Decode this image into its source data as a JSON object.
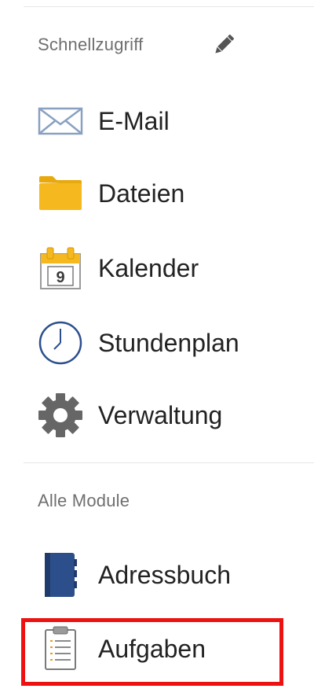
{
  "quick_access": {
    "title": "Schnellzugriff",
    "edit_icon": "pencil-icon",
    "items": [
      {
        "label": "E-Mail",
        "icon": "envelope-icon"
      },
      {
        "label": "Dateien",
        "icon": "folder-icon"
      },
      {
        "label": "Kalender",
        "icon": "calendar-icon"
      },
      {
        "label": "Stundenplan",
        "icon": "clock-icon"
      },
      {
        "label": "Verwaltung",
        "icon": "gear-icon"
      }
    ]
  },
  "all_modules": {
    "title": "Alle Module",
    "items": [
      {
        "label": "Adressbuch",
        "icon": "address-book-icon"
      },
      {
        "label": "Aufgaben",
        "icon": "clipboard-icon",
        "highlighted": true
      }
    ]
  },
  "calendar_icon_day": "9",
  "colors": {
    "highlight": "#ee1111",
    "folder": "#f5b81e",
    "icon_blue": "#2c4f8c",
    "gear": "#666666",
    "section_text": "#6f6f6f"
  }
}
